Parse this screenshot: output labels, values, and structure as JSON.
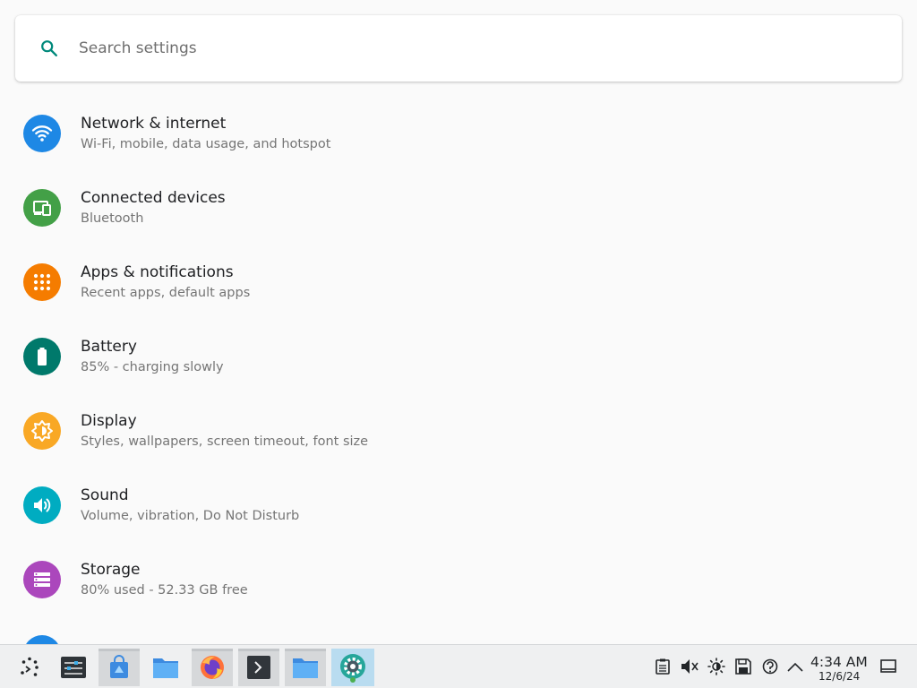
{
  "search": {
    "placeholder": "Search settings",
    "value": "",
    "icon": "search-icon"
  },
  "settings": [
    {
      "title": "Network & internet",
      "subtitle": "Wi-Fi, mobile, data usage, and hotspot",
      "icon": "wifi-icon",
      "color": "#1e88e5"
    },
    {
      "title": "Connected devices",
      "subtitle": "Bluetooth",
      "icon": "devices-icon",
      "color": "#43a047"
    },
    {
      "title": "Apps & notifications",
      "subtitle": "Recent apps, default apps",
      "icon": "apps-grid-icon",
      "color": "#f57c00"
    },
    {
      "title": "Battery",
      "subtitle": "85% - charging slowly",
      "icon": "battery-icon",
      "color": "#00796b"
    },
    {
      "title": "Display",
      "subtitle": "Styles, wallpapers, screen timeout, font size",
      "icon": "brightness-icon",
      "color": "#f9a825"
    },
    {
      "title": "Sound",
      "subtitle": "Volume, vibration, Do Not Disturb",
      "icon": "volume-icon",
      "color": "#00acc1"
    },
    {
      "title": "Storage",
      "subtitle": "80% used - 52.33 GB free",
      "icon": "storage-icon",
      "color": "#ab47bc"
    },
    {
      "title": "",
      "subtitle": "",
      "icon": "privacy-icon",
      "color": "#1e88e5"
    }
  ],
  "taskbar": {
    "launcher_icon": "app-launcher-icon",
    "apps": [
      {
        "name": "system-settings-app",
        "state": "normal"
      },
      {
        "name": "app-store-app",
        "state": "active"
      },
      {
        "name": "file-manager-app",
        "state": "normal"
      },
      {
        "name": "firefox-app",
        "state": "active"
      },
      {
        "name": "terminal-app",
        "state": "active"
      },
      {
        "name": "file-manager-app-2",
        "state": "active"
      },
      {
        "name": "android-settings-app",
        "state": "highlight"
      }
    ],
    "tray": [
      "clipboard-icon",
      "volume-muted-icon",
      "brightness-icon",
      "drive-icon",
      "updates-icon",
      "chevron-up-icon"
    ],
    "clock": {
      "time": "4:34 AM",
      "date": "12/6/24"
    },
    "show_desktop_icon": "show-desktop-icon",
    "colors": {
      "background": "#eff0f1",
      "active": "#d6d8da",
      "highlight": "#b9dcf0"
    }
  }
}
